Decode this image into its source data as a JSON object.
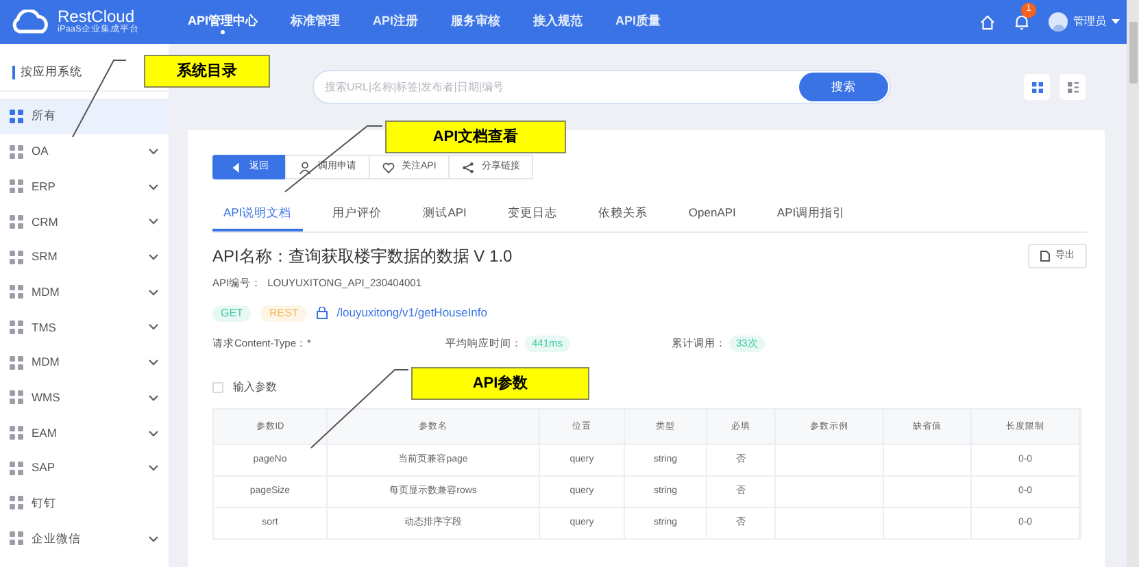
{
  "app": {
    "logo_title": "RestCloud",
    "logo_subtitle": "iPaaS企业集成平台"
  },
  "nav": [
    {
      "label": "API管理中心",
      "selected": true
    },
    {
      "label": "标准管理",
      "selected": false
    },
    {
      "label": "API注册",
      "selected": false
    },
    {
      "label": "服务审核",
      "selected": false
    },
    {
      "label": "接入规范",
      "selected": false
    },
    {
      "label": "API质量",
      "selected": false
    }
  ],
  "notification_count": "1",
  "user": "管理员",
  "sidebar": {
    "title": "按应用系统",
    "items": [
      {
        "label": "所有",
        "selected": true,
        "expandable": false
      },
      {
        "label": "OA",
        "selected": false,
        "expandable": true
      },
      {
        "label": "ERP",
        "selected": false,
        "expandable": true
      },
      {
        "label": "CRM",
        "selected": false,
        "expandable": true
      },
      {
        "label": "SRM",
        "selected": false,
        "expandable": true
      },
      {
        "label": "MDM",
        "selected": false,
        "expandable": true
      },
      {
        "label": "TMS",
        "selected": false,
        "expandable": true
      },
      {
        "label": "MDM",
        "selected": false,
        "expandable": true
      },
      {
        "label": "WMS",
        "selected": false,
        "expandable": true
      },
      {
        "label": "EAM",
        "selected": false,
        "expandable": true
      },
      {
        "label": "SAP",
        "selected": false,
        "expandable": true
      },
      {
        "label": "钉钉",
        "selected": false,
        "expandable": false
      },
      {
        "label": "企业微信",
        "selected": false,
        "expandable": true
      }
    ]
  },
  "search": {
    "placeholder": "搜索URL|名称|标签|发布者|日期|编号",
    "button": "搜索"
  },
  "view_toggles": [
    {
      "kind": "grid",
      "selected": true
    },
    {
      "kind": "list",
      "selected": false
    }
  ],
  "actions": [
    {
      "label": "返回",
      "kind": "back"
    },
    {
      "label": "调用申请",
      "kind": "apply"
    },
    {
      "label": "关注API",
      "kind": "follow"
    },
    {
      "label": "分享链接",
      "kind": "share"
    }
  ],
  "tabs": [
    {
      "label": "API说明文档",
      "selected": true
    },
    {
      "label": "用户评价",
      "selected": false
    },
    {
      "label": "测试API",
      "selected": false
    },
    {
      "label": "变更日志",
      "selected": false
    },
    {
      "label": "依赖关系",
      "selected": false
    },
    {
      "label": "OpenAPI",
      "selected": false
    },
    {
      "label": "API调用指引",
      "selected": false
    }
  ],
  "api": {
    "title": "API名称：查询获取楼宇数据的数据 V 1.0",
    "export": "导出",
    "code_label": "API编号：",
    "code": "LOUYUXITONG_API_230404001",
    "method": "GET",
    "protocol": "REST",
    "path": "/louyuxitong/v1/getHouseInfo"
  },
  "stats": [
    {
      "label": "请求Content-Type：",
      "value": "*",
      "kind": "plain"
    },
    {
      "label": "平均响应时间：",
      "value": "441ms",
      "kind": "tag"
    },
    {
      "label": "累计调用：",
      "value": "33次",
      "kind": "tag"
    }
  ],
  "params": {
    "label": "输入参数",
    "checked": false,
    "columns": [
      "参数ID",
      "参数名",
      "位置",
      "类型",
      "必填",
      "参数示例",
      "缺省值",
      "长度限制"
    ],
    "rows": [
      {
        "id": "pageNo",
        "name": "当前页兼容page",
        "position": "query",
        "type": "string",
        "required": "否",
        "length": "0-0"
      },
      {
        "id": "pageSize",
        "name": "每页显示数兼容rows",
        "position": "query",
        "type": "string",
        "required": "否",
        "length": "0-0"
      },
      {
        "id": "sort",
        "name": "动态排序字段",
        "position": "query",
        "type": "string",
        "required": "否",
        "length": "0-0"
      }
    ]
  },
  "callouts": [
    {
      "text": "系统目录"
    },
    {
      "text": "API文档查看"
    },
    {
      "text": "API参数"
    }
  ]
}
